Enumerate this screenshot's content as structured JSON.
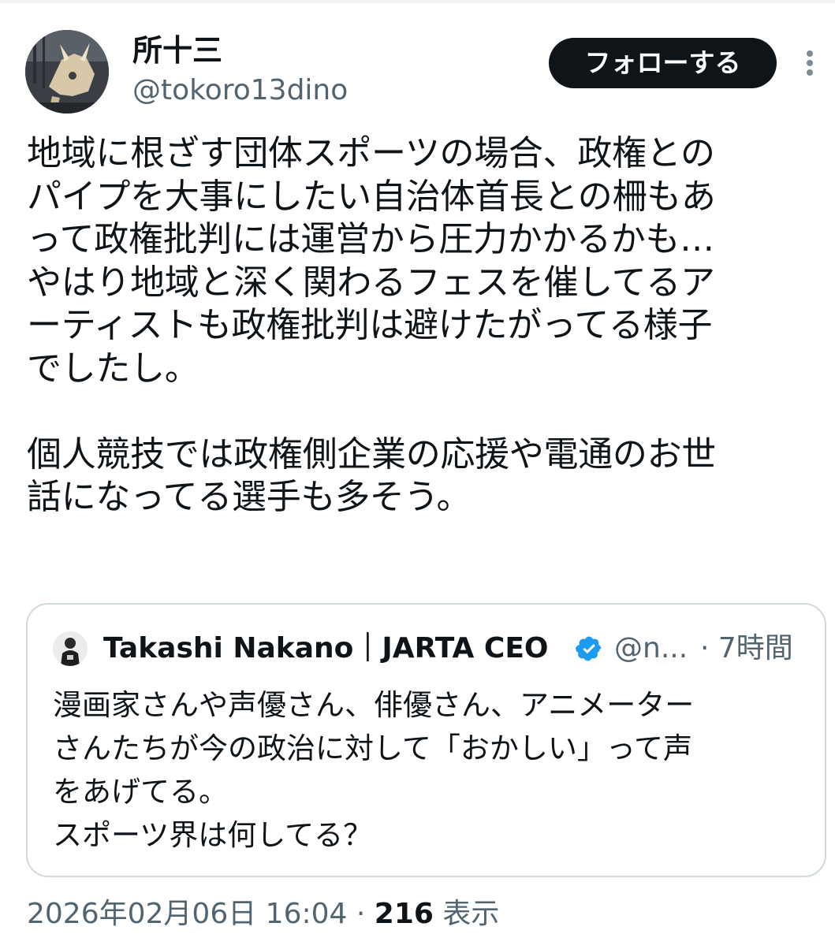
{
  "author": {
    "display_name": "所十三",
    "handle": "@tokoro13dino"
  },
  "follow_button": "フォローする",
  "more_icon": "more-vertical-icon",
  "tweet_text": "地域に根ざす団体スポーツの場合、政権との\nパイプを大事にしたい自治体首長との柵もあ\nって政権批判には運営から圧力かかるかも…\nやはり地域と深く関わるフェスを催してるア\nーティストも政権批判は避けたがってる様子\nでしたし。\n\n個人競技では政権側企業の応援や電通のお世\n話になってる選手も多そう。",
  "quote": {
    "display_name": "Takashi Nakano｜JARTA CEO",
    "verified_icon": "verified-badge-icon",
    "handle": "@n...",
    "time": "· 7時間",
    "text": "漫画家さんや声優さん、俳優さん、アニメーター\nさんたちが今の政治に対して「おかしい」って声\nをあげてる。\nスポーツ界は何してる？"
  },
  "meta": {
    "timestamp": "2026年02月06日 16:04",
    "separator": "·",
    "views_count": "216",
    "views_label": "表示"
  },
  "colors": {
    "text": "#0f1419",
    "secondary": "#536471",
    "border": "#cfd9de",
    "button_bg": "#0f1419",
    "verified": "#1d9bf0"
  }
}
